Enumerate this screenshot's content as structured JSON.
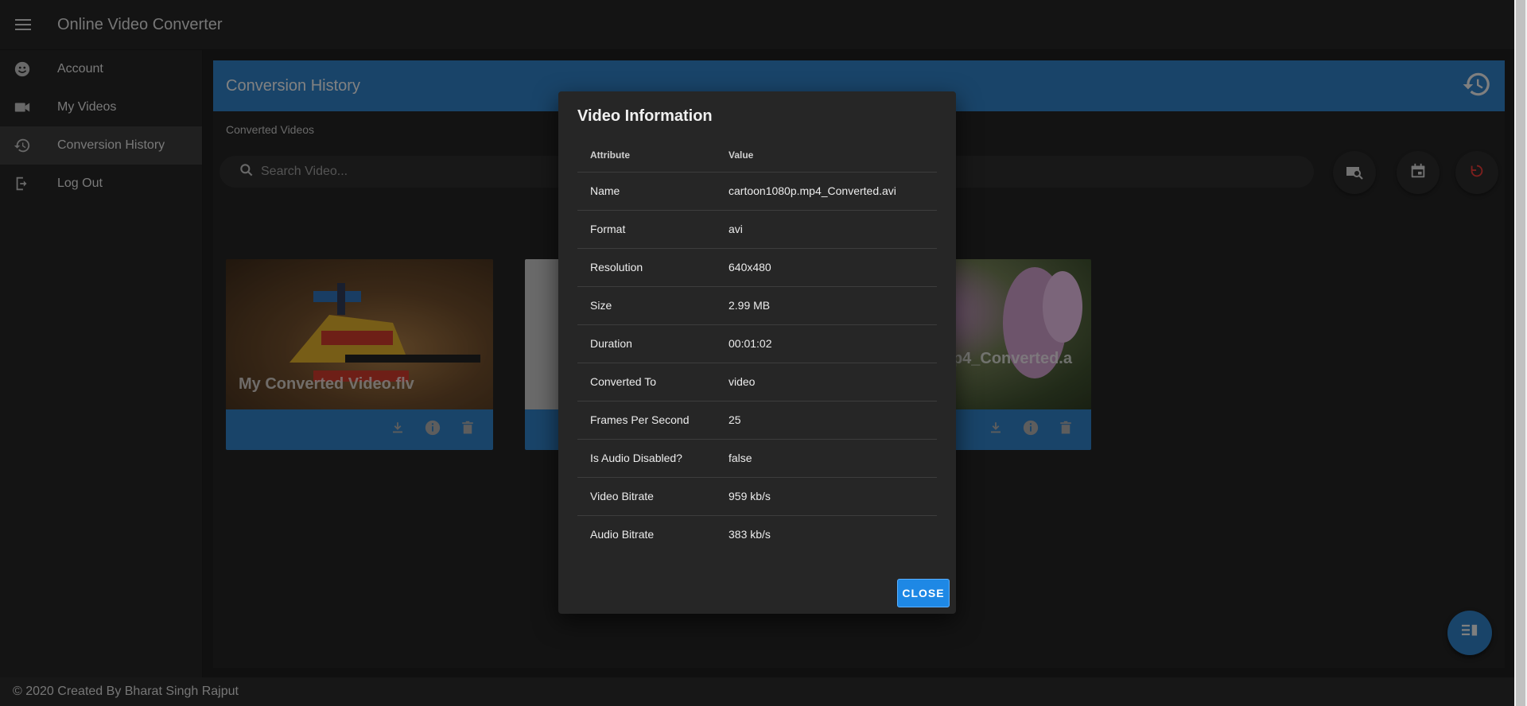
{
  "app": {
    "title": "Online Video Converter"
  },
  "sidebar": {
    "items": [
      {
        "label": "Account",
        "icon": "account-icon"
      },
      {
        "label": "My Videos",
        "icon": "video-camera-icon"
      },
      {
        "label": "Conversion History",
        "icon": "history-icon",
        "active": true
      },
      {
        "label": "Log Out",
        "icon": "logout-icon"
      }
    ]
  },
  "panel": {
    "title": "Conversion History",
    "subtitle": "Converted Videos",
    "search_placeholder": "Search Video..."
  },
  "cards": [
    {
      "title": "My Converted Video.flv"
    },
    {
      "title": ""
    },
    {
      "title": "p4_Converted.a"
    }
  ],
  "dialog": {
    "title": "Video Information",
    "headers": {
      "attribute": "Attribute",
      "value": "Value"
    },
    "rows": [
      {
        "attribute": "Name",
        "value": "cartoon1080p.mp4_Converted.avi"
      },
      {
        "attribute": "Format",
        "value": "avi"
      },
      {
        "attribute": "Resolution",
        "value": "640x480"
      },
      {
        "attribute": "Size",
        "value": "2.99 MB"
      },
      {
        "attribute": "Duration",
        "value": "00:01:02"
      },
      {
        "attribute": "Converted To",
        "value": "video"
      },
      {
        "attribute": "Frames Per Second",
        "value": "25"
      },
      {
        "attribute": "Is Audio Disabled?",
        "value": "false"
      },
      {
        "attribute": "Video Bitrate",
        "value": "959 kb/s"
      },
      {
        "attribute": "Audio Bitrate",
        "value": "383 kb/s"
      }
    ],
    "close_label": "CLOSE"
  },
  "footer": {
    "text": "© 2020 Created By Bharat Singh Rajput"
  },
  "colors": {
    "accent": "#2e7cc0",
    "button": "#1e88e5",
    "refresh": "#e53935"
  }
}
